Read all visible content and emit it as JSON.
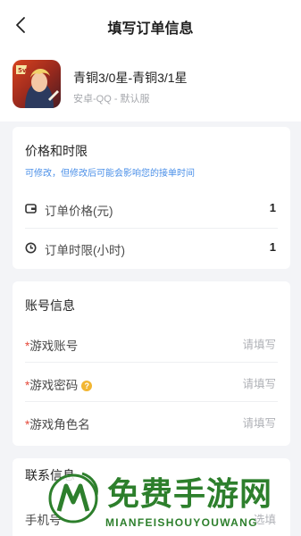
{
  "header": {
    "title": "填写订单信息"
  },
  "game": {
    "title": "青铜3/0星-青铜3/1星",
    "subtitle": "安卓-QQ - 默认服",
    "icon": "game-hero-icon"
  },
  "price_section": {
    "title": "价格和时限",
    "hint": "可修改，但修改后可能会影响您的接单时间",
    "rows": [
      {
        "label": "订单价格(元)",
        "value": "1",
        "icon": "wallet-icon"
      },
      {
        "label": "订单时限(小时)",
        "value": "1",
        "icon": "clock-icon"
      }
    ]
  },
  "account_section": {
    "title": "账号信息",
    "fields": [
      {
        "required": "*",
        "label": "游戏账号",
        "placeholder": "请填写"
      },
      {
        "required": "*",
        "label": "游戏密码",
        "placeholder": "请填写",
        "help": "?"
      },
      {
        "required": "*",
        "label": "游戏角色名",
        "placeholder": "请填写"
      }
    ]
  },
  "contact_section": {
    "title": "联系信息",
    "fields": [
      {
        "label": "手机号",
        "placeholder": "选填"
      }
    ]
  },
  "watermark": {
    "text": "免费手游网",
    "sub": "MIANFEISHOUYOUWANG",
    "color": "#2d7f2c"
  }
}
